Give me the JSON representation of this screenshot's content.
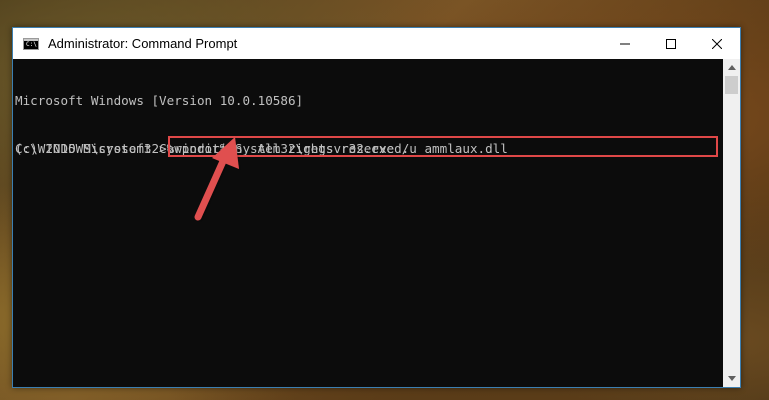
{
  "window": {
    "title": "Administrator: Command Prompt",
    "icon_text": "C:\\"
  },
  "controls": {
    "minimize": "—",
    "maximize": "☐",
    "close": "✕"
  },
  "console": {
    "lines": [
      "Microsoft Windows [Version 10.0.10586]",
      "(c) 2015 Microsoft Corporotion. All rights reserved."
    ],
    "prompt": "C:\\WINDOWS\\system32>",
    "command": "%windir%\\System32\\regsvr32.exe /u ammlaux.dll"
  },
  "colors": {
    "highlight": "#e04848",
    "arrow": "#e05050",
    "console_bg": "#0c0c0c",
    "console_text": "#c0c0c0"
  },
  "icons": [
    "cmd-app-icon",
    "minimize-icon",
    "maximize-icon",
    "close-icon",
    "scroll-up-icon",
    "scroll-down-icon",
    "arrow-annotation-icon"
  ]
}
